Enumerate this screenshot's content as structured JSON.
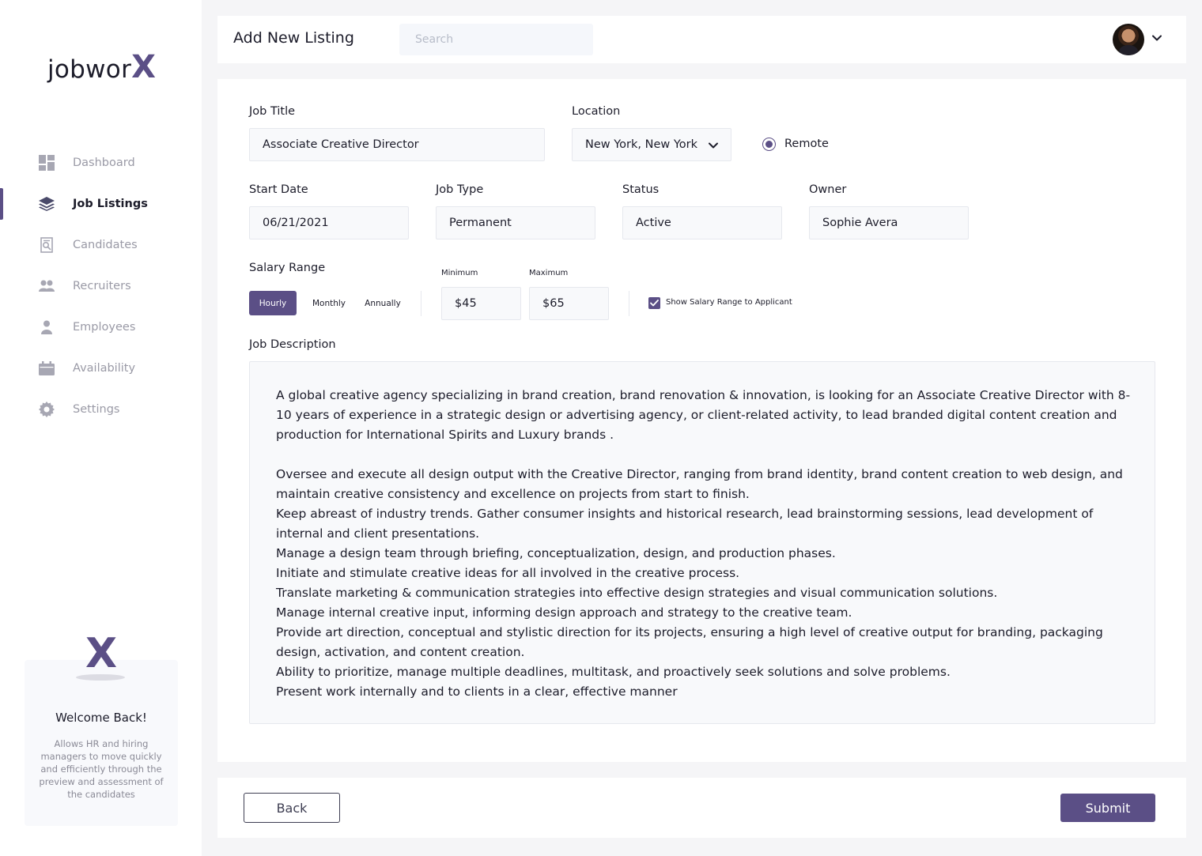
{
  "brand": {
    "logo_text": "jobwor",
    "logo_x": "X",
    "accent": "#5b4f86"
  },
  "sidebar": {
    "items": [
      {
        "label": "Dashboard",
        "icon": "dashboard-icon"
      },
      {
        "label": "Job Listings",
        "icon": "layers-icon",
        "active": true
      },
      {
        "label": "Candidates",
        "icon": "candidates-icon"
      },
      {
        "label": "Recruiters",
        "icon": "recruiters-icon"
      },
      {
        "label": "Employees",
        "icon": "employee-icon"
      },
      {
        "label": "Availability",
        "icon": "calendar-icon"
      },
      {
        "label": "Settings",
        "icon": "gear-icon"
      }
    ],
    "welcome": {
      "logo": "X",
      "title": "Welcome Back!",
      "text": "Allows HR and hiring managers to move quickly and efficiently through the preview and assessment of the candidates"
    }
  },
  "header": {
    "title": "Add New Listing",
    "search_placeholder": "Search"
  },
  "form": {
    "job_title": {
      "label": "Job Title",
      "value": "Associate Creative Director"
    },
    "location": {
      "label": "Location",
      "value": "New York, New York"
    },
    "remote": {
      "label": "Remote",
      "checked": true
    },
    "start_date": {
      "label": "Start Date",
      "value": "06/21/2021"
    },
    "job_type": {
      "label": "Job Type",
      "value": "Permanent"
    },
    "status": {
      "label": "Status",
      "value": "Active"
    },
    "owner": {
      "label": "Owner",
      "value": "Sophie Avera"
    },
    "salary": {
      "label": "Salary Range",
      "periods": [
        "Hourly",
        "Monthly",
        "Annually"
      ],
      "selected_period": "Hourly",
      "min_label": "Minimum",
      "min_value": "$45",
      "max_label": "Maximum",
      "max_value": "$65",
      "show_label": "Show Salary Range to Applicant",
      "show_checked": true
    },
    "description": {
      "label": "Job Description",
      "intro": "A global creative agency specializing in brand creation, brand renovation & innovation, is looking for an Associate Creative Director with 8-10 years of experience in a strategic design or advertising agency, or client-related activity, to lead branded digital content creation and production for International Spirits and Luxury brands .",
      "lines": [
        "Oversee and execute all design output with the Creative Director, ranging from brand identity, brand content creation to web design, and maintain creative consistency and excellence on projects from start to finish.",
        "Keep abreast of industry trends.  Gather consumer insights and historical research, lead brainstorming sessions, lead development of internal and client presentations.",
        "Manage a design team through briefing, conceptualization, design, and production phases.",
        "Initiate and stimulate creative ideas for all involved in the creative process.",
        "Translate marketing & communication strategies into effective design strategies and visual communication solutions.",
        "Manage internal creative input, informing design approach and strategy to the creative team.",
        "Provide art direction, conceptual and stylistic direction for its projects, ensuring a high level of creative output for branding, packaging design, activation, and content creation.",
        "Ability to prioritize, manage multiple deadlines, multitask, and proactively seek solutions and solve problems.",
        "Present work internally and to clients in a clear, effective manner"
      ]
    }
  },
  "footer": {
    "back_label": "Back",
    "submit_label": "Submit"
  }
}
